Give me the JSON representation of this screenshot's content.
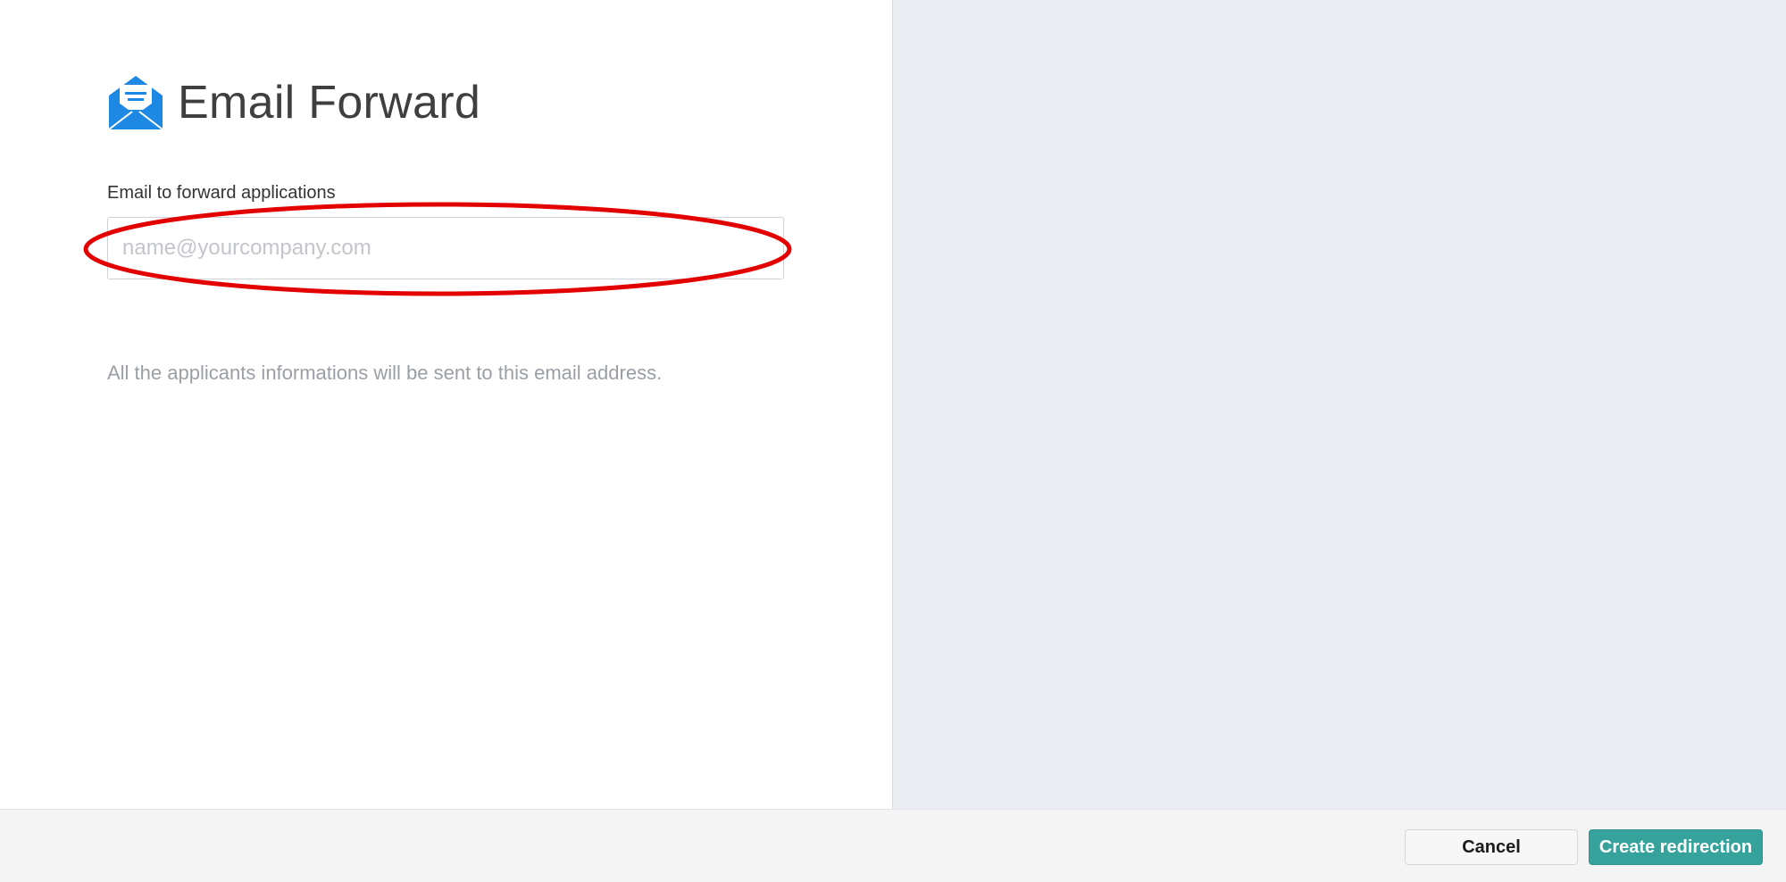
{
  "header": {
    "icon": "envelope-icon",
    "title": "Email Forward"
  },
  "form": {
    "label": "Email to forward applications",
    "email_value": "",
    "email_placeholder": "name@yourcompany.com",
    "help_text": "All the applicants informations will be sent to this email address."
  },
  "footer": {
    "cancel_label": "Cancel",
    "create_label": "Create redirection"
  },
  "colors": {
    "accent": "#35a39c",
    "icon_blue": "#1e88e5",
    "highlight": "#e30000",
    "right_pane": "#e9ecf0"
  }
}
